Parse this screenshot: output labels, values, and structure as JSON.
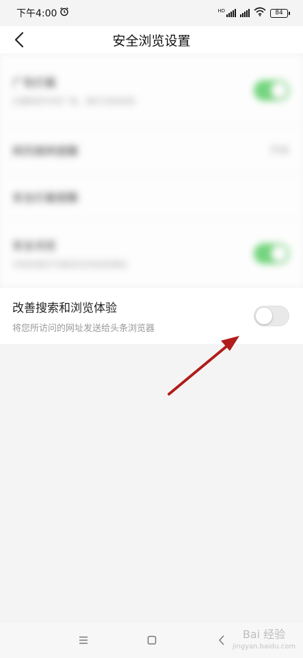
{
  "status": {
    "time": "下午4:00",
    "hd": "HD",
    "battery": "84"
  },
  "header": {
    "title": "安全浏览设置"
  },
  "settings": {
    "blurred_rows": [
      {
        "title": "广告拦截",
        "sub": "拦截网页中的广告，提升浏览体验",
        "control": "toggle-on"
      },
      {
        "title": "网页跳转提醒",
        "value": "开启",
        "control": "value"
      },
      {
        "title": "安全拦截提醒",
        "control": "none"
      },
      {
        "title": "安全浏览",
        "sub": "识别并提示可能存在风险的网站",
        "control": "toggle-on"
      }
    ],
    "active": {
      "title": "改善搜索和浏览体验",
      "subtitle": "将您所访问的网址发送给头条浏览器",
      "toggle_state": "off"
    }
  },
  "watermark": {
    "text": "Bai 经验",
    "sub": "jingyan.baidu.com"
  },
  "colors": {
    "accent_green": "#5fd06a",
    "arrow_red": "#b01c1c",
    "background": "#f4f4f4"
  }
}
